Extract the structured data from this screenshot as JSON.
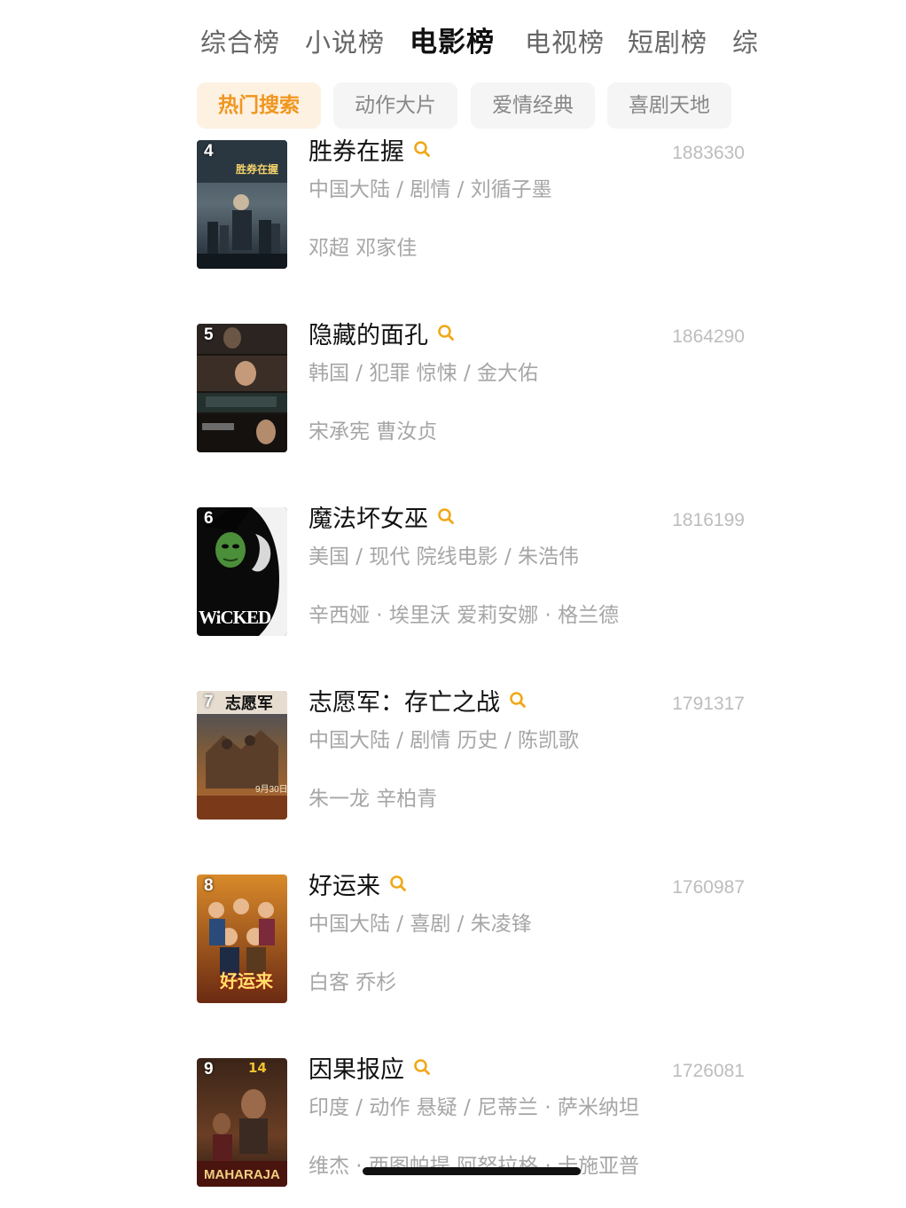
{
  "top_tabs": [
    {
      "label": "综合榜",
      "active": false
    },
    {
      "label": "小说榜",
      "active": false
    },
    {
      "label": "电影榜",
      "active": true
    },
    {
      "label": "电视榜",
      "active": false
    },
    {
      "label": "短剧榜",
      "active": false
    },
    {
      "label": "综",
      "active": false
    }
  ],
  "sub_tabs": [
    {
      "label": "热门搜索",
      "active": true
    },
    {
      "label": "动作大片",
      "active": false
    },
    {
      "label": "爱情经典",
      "active": false
    },
    {
      "label": "喜剧天地",
      "active": false
    }
  ],
  "colors": {
    "accent": "#f0961f",
    "accent_bg": "#fdf1e2",
    "muted_text": "#a6a6a6"
  },
  "movies": [
    {
      "rank": "4",
      "title": "胜券在握",
      "heat": "1883630",
      "meta": "中国大陆 / 剧情 / 刘循子墨",
      "cast": "邓超 邓家佳",
      "poster_text": "胜券在握"
    },
    {
      "rank": "5",
      "title": "隐藏的面孔",
      "heat": "1864290",
      "meta": "韩国 / 犯罪 惊悚 / 金大佑",
      "cast": "宋承宪 曹汝贞",
      "poster_text": ""
    },
    {
      "rank": "6",
      "title": "魔法坏女巫",
      "heat": "1816199",
      "meta": "美国 / 现代 院线电影 / 朱浩伟",
      "cast": "辛西娅 · 埃里沃 爱莉安娜 · 格兰德",
      "poster_text": "WiCKED"
    },
    {
      "rank": "7",
      "title": "志愿军：存亡之战",
      "heat": "1791317",
      "meta": "中国大陆 / 剧情 历史 / 陈凯歌",
      "cast": "朱一龙 辛柏青",
      "poster_text": "志愿军"
    },
    {
      "rank": "8",
      "title": "好运来",
      "heat": "1760987",
      "meta": "中国大陆 / 喜剧 / 朱凌锋",
      "cast": "白客 乔杉",
      "poster_text": "好运来"
    },
    {
      "rank": "9",
      "title": "因果报应",
      "heat": "1726081",
      "meta": "印度 / 动作 悬疑 / 尼蒂兰 · 萨米纳坦",
      "cast": "维杰 · 西图帕提 阿努拉格 · 卡施亚普",
      "poster_text": "14"
    }
  ]
}
